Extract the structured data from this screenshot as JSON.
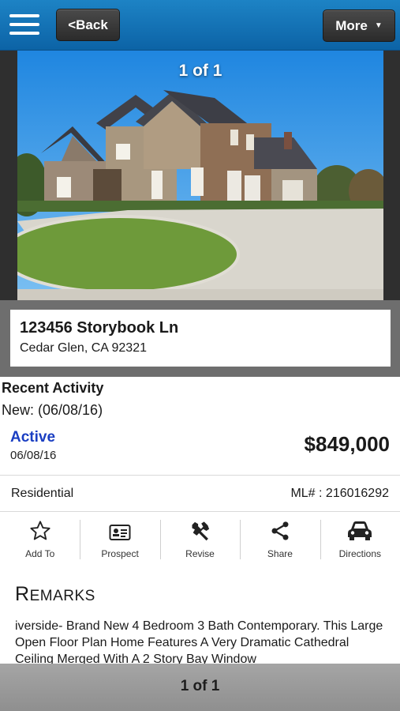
{
  "header": {
    "back_label": "<Back",
    "more_label": "More",
    "more_caret": "▼"
  },
  "photo": {
    "counter": "1 of 1"
  },
  "listing": {
    "street": "123456 Storybook Ln",
    "city_line": "Cedar Glen, CA 92321"
  },
  "activity": {
    "title": "Recent Activity",
    "new_line": "New: (06/08/16)",
    "status": "Active",
    "status_date": "06/08/16",
    "price": "$849,000",
    "property_type": "Residential",
    "ml_number": "ML# : 216016292"
  },
  "actions": [
    {
      "label": "Add To",
      "icon": "star-icon"
    },
    {
      "label": "Prospect",
      "icon": "id-card-icon"
    },
    {
      "label": "Revise",
      "icon": "wrench-icon"
    },
    {
      "label": "Share",
      "icon": "share-icon"
    },
    {
      "label": "Directions",
      "icon": "car-icon"
    }
  ],
  "remarks": {
    "title_cap": "R",
    "title_rest": "EMARKS",
    "text": "iverside- Brand New 4 Bedroom 3 Bath Contemporary. This Large Open Floor Plan Home Features A Very Dramatic Cathedral Ceiling Merged With A 2 Story Bay Window"
  },
  "footer": {
    "counter": "1 of 1"
  },
  "colors": {
    "header_blue": "#1478bd",
    "status_blue": "#1a3ec2"
  }
}
